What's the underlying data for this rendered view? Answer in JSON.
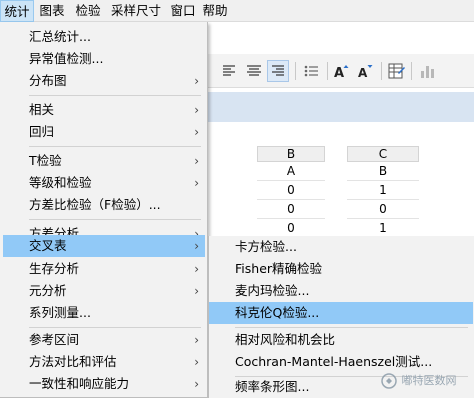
{
  "menubar": {
    "items": [
      "统计",
      "图表",
      "检验",
      "采样尺寸",
      "窗口",
      "帮助"
    ]
  },
  "menu_stats": {
    "items": [
      {
        "label": "汇总统计...",
        "has_submenu": false
      },
      {
        "label": "异常值检测...",
        "has_submenu": false
      },
      {
        "label": "分布图",
        "has_submenu": true
      },
      {
        "label": "相关",
        "has_submenu": true
      },
      {
        "label": "回归",
        "has_submenu": true
      },
      {
        "label": "T检验",
        "has_submenu": true
      },
      {
        "label": "等级和检验",
        "has_submenu": true
      },
      {
        "label": "方差比检验（F检验）...",
        "has_submenu": false
      },
      {
        "label": "方差分析",
        "has_submenu": true
      },
      {
        "label": "交叉表",
        "has_submenu": true
      },
      {
        "label": "生存分析",
        "has_submenu": true
      },
      {
        "label": "元分析",
        "has_submenu": true
      },
      {
        "label": "系列测量...",
        "has_submenu": false
      },
      {
        "label": "参考区间",
        "has_submenu": true
      },
      {
        "label": "方法对比和评估",
        "has_submenu": true
      },
      {
        "label": "一致性和响应能力",
        "has_submenu": true
      }
    ],
    "highlighted": "交叉表"
  },
  "menu_crosstab": {
    "items": [
      "卡方检验...",
      "Fisher精确检验",
      "麦内玛检验...",
      "科克伦Q检验...",
      "相对风险和机会比",
      "Cochran-Mantel-Haenszel测试...",
      "频率条形图..."
    ],
    "highlighted": "科克伦Q检验..."
  },
  "sheet": {
    "col_b": "B",
    "col_c": "C",
    "rows": [
      {
        "b": "A",
        "c": "B"
      },
      {
        "b": "0",
        "c": "1"
      },
      {
        "b": "0",
        "c": "0"
      },
      {
        "b": "0",
        "c": "1"
      }
    ]
  },
  "watermark": "嘟特医数网",
  "colors": {
    "highlight": "#91c9f7",
    "menu_bg": "#f2f2f2",
    "band": "#d8e4f2"
  }
}
